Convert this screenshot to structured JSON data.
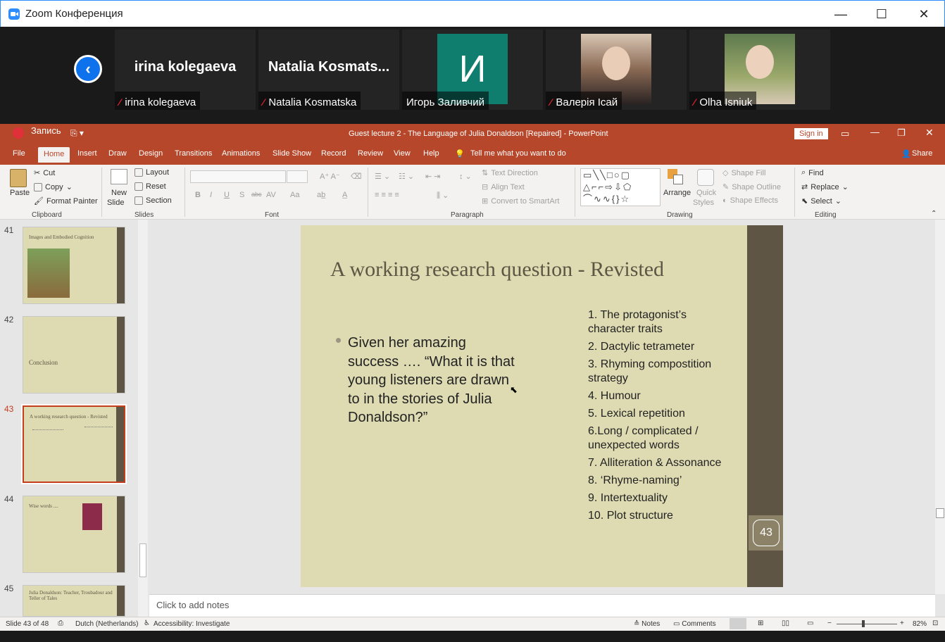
{
  "zoom": {
    "title": "Zoom Конференция",
    "participants": [
      {
        "big_name": "irina kolegaeva",
        "label": "irina kolegaeva",
        "muted": true
      },
      {
        "big_name": "Natalia  Kosmats...",
        "label": "Natalia Kosmatska",
        "muted": true
      },
      {
        "avatar_letter": "И",
        "avatar_color": "#0f7e6e",
        "label": "Игорь Заливчий",
        "muted": false
      },
      {
        "label": "Валерія Ісай",
        "muted": true
      },
      {
        "label": "Olha Isniuk",
        "muted": true
      }
    ]
  },
  "ppt": {
    "title": "Guest lecture 2 - The Language of Julia Donaldson [Repaired]  -  PowerPoint",
    "recording": "Запись",
    "sign_in": "Sign in",
    "share": "Share",
    "tell_me": "Tell me what you want to do",
    "accent": "#b7472a",
    "tabs": [
      "File",
      "Home",
      "Insert",
      "Draw",
      "Design",
      "Transitions",
      "Animations",
      "Slide Show",
      "Record",
      "Review",
      "View",
      "Help"
    ],
    "ribbon": {
      "clipboard": {
        "label": "Clipboard",
        "paste": "Paste",
        "cut": "Cut",
        "copy": "Copy",
        "format_painter": "Format Painter"
      },
      "slides": {
        "label": "Slides",
        "new_slide_1": "New",
        "new_slide_2": "Slide",
        "layout": "Layout",
        "reset": "Reset",
        "section": "Section"
      },
      "font": {
        "label": "Font",
        "bold": "B",
        "italic": "I",
        "underline": "U",
        "shadow": "S",
        "strike": "abc",
        "spacing": "AV",
        "case": "Aa"
      },
      "paragraph": {
        "label": "Paragraph",
        "text_direction": "Text Direction",
        "align_text": "Align Text",
        "smartart": "Convert to SmartArt"
      },
      "drawing": {
        "label": "Drawing",
        "arrange": "Arrange",
        "quick_styles_1": "Quick",
        "quick_styles_2": "Styles",
        "shape_fill": "Shape Fill",
        "shape_outline": "Shape Outline",
        "shape_effects": "Shape Effects"
      },
      "editing": {
        "label": "Editing",
        "find": "Find",
        "replace": "Replace",
        "select": "Select"
      }
    },
    "thumbnails": [
      {
        "num": "41",
        "title": "Images and Embodied Cognition"
      },
      {
        "num": "42",
        "title": "Conclusion"
      },
      {
        "num": "43",
        "title": "A working research question - Revisted"
      },
      {
        "num": "44",
        "title": "Wise words ...."
      },
      {
        "num": "45",
        "title": "Julia Donaldson: Teacher, Troubadour and Teller of Tales"
      }
    ],
    "slide": {
      "title": "A working research question - Revisted",
      "bullet": "Given her amazing success …. “What it is that young listeners are drawn to in the stories of Julia Donaldson?”",
      "list": [
        "1. The protagonist’s character traits",
        "2. Dactylic tetrameter",
        "3. Rhyming compostition strategy",
        "4. Humour",
        "5. Lexical repetition",
        "6.Long / complicated / unexpected words",
        "7. Alliteration & Assonance",
        "8. ‘Rhyme-naming’",
        "9. Intertextuality",
        "10. Plot structure"
      ],
      "page_number": "43"
    },
    "notes_placeholder": "Click to add notes",
    "status": {
      "slide_of": "Slide 43 of 48",
      "language": "Dutch (Netherlands)",
      "accessibility": "Accessibility: Investigate",
      "notes": "Notes",
      "comments": "Comments",
      "zoom": "82%"
    }
  }
}
